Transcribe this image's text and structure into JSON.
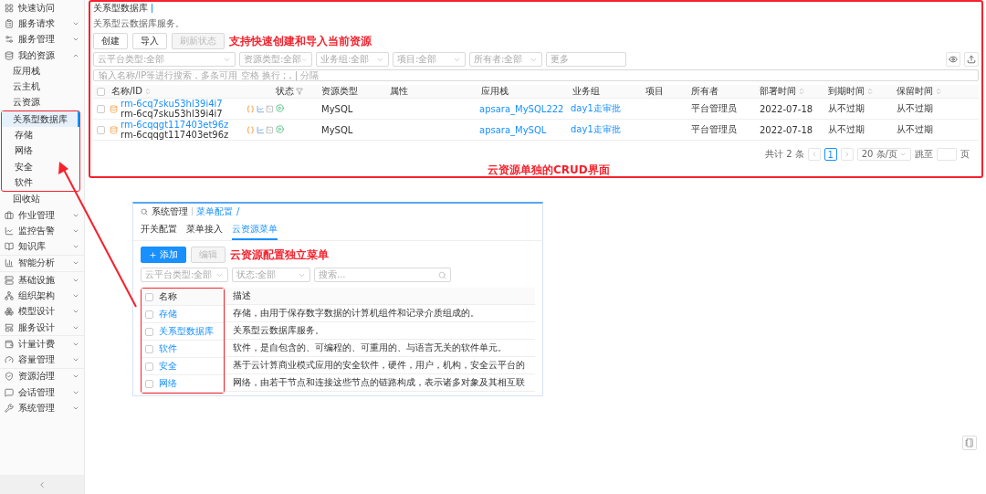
{
  "sidebar": {
    "sections": [
      {
        "items": [
          {
            "label": "快速访问"
          },
          {
            "label": "服务请求",
            "expanded": false
          },
          {
            "label": "服务管理",
            "expanded": false
          },
          {
            "label": "我的资源",
            "expanded": true,
            "children": [
              {
                "label": "应用栈",
                "selected": false,
                "highlighted": false
              },
              {
                "label": "云主机",
                "selected": false,
                "highlighted": false
              },
              {
                "label": "云资源",
                "selected": false,
                "highlighted": false
              },
              {
                "label": "关系型数据库",
                "selected": true,
                "highlighted": true
              },
              {
                "label": "存储",
                "selected": false,
                "highlighted": true
              },
              {
                "label": "网络",
                "selected": false,
                "highlighted": true
              },
              {
                "label": "安全",
                "selected": false,
                "highlighted": true
              },
              {
                "label": "软件",
                "selected": false,
                "highlighted": true
              },
              {
                "label": "回收站",
                "selected": false,
                "highlighted": false
              }
            ]
          },
          {
            "label": "作业管理",
            "expanded": false
          },
          {
            "label": "监控告警",
            "expanded": false
          },
          {
            "label": "知识库",
            "expanded": false
          }
        ]
      },
      {
        "items": [
          {
            "label": "智能分析",
            "expanded": false
          }
        ]
      },
      {
        "items": [
          {
            "label": "基础设施",
            "expanded": false
          },
          {
            "label": "组织架构",
            "expanded": false
          },
          {
            "label": "模型设计",
            "expanded": false
          },
          {
            "label": "服务设计",
            "expanded": false
          }
        ]
      },
      {
        "items": [
          {
            "label": "计量计费",
            "expanded": false
          },
          {
            "label": "容量管理",
            "expanded": false
          }
        ]
      },
      {
        "items": [
          {
            "label": "资源治理",
            "expanded": false
          },
          {
            "label": "会话管理",
            "expanded": false
          },
          {
            "label": "系统管理",
            "expanded": false
          }
        ]
      }
    ]
  },
  "resource_page": {
    "breadcrumb": "关系型数据库",
    "description": "关系型云数据库服务。",
    "buttons": [
      {
        "label": "创建",
        "disabled": false
      },
      {
        "label": "导入",
        "disabled": false
      },
      {
        "label": "刷新状态",
        "disabled": true
      }
    ],
    "annotation": "支持快速创建和导入当前资源",
    "filters": [
      {
        "label": "云平台类型:全部",
        "kind": "select"
      },
      {
        "label": "资源类型:全部",
        "kind": "select"
      },
      {
        "label": "业务组:全部",
        "kind": "select"
      },
      {
        "label": "项目:全部",
        "kind": "select"
      },
      {
        "label": "所有者:全部",
        "kind": "select"
      },
      {
        "label": "更多",
        "kind": "more"
      }
    ],
    "search": {
      "placeholder": "输入名称/IP等进行搜索，多条可用 空格 换行 ; , | 分隔"
    },
    "table": {
      "all_selected": false,
      "columns": [
        {
          "label": "名称/ID",
          "kind": "sort"
        },
        {
          "label": "状态",
          "kind": "filter"
        },
        {
          "label": "资源类型",
          "kind": "plain"
        },
        {
          "label": "属性",
          "kind": "plain"
        },
        {
          "label": "应用栈",
          "kind": "plain"
        },
        {
          "label": "业务组",
          "kind": "plain"
        },
        {
          "label": "项目",
          "kind": "plain"
        },
        {
          "label": "所有者",
          "kind": "plain"
        },
        {
          "label": "部署时间",
          "kind": "sort"
        },
        {
          "label": "到期时间",
          "kind": "sort"
        },
        {
          "label": "保留时间",
          "kind": "sort"
        }
      ],
      "rows": [
        {
          "selected": false,
          "name": "rm-6cq7sku53hl39i4i7",
          "id": "rm-6cq7sku53hl39i4i7",
          "type": "MySQL",
          "stack": "apsara_MySQL222",
          "group": "day1走审批",
          "owner": "平台管理员",
          "deployed": "2022-07-18",
          "expires": "从不过期",
          "retention": "从不过期"
        },
        {
          "selected": false,
          "name": "rm-6cqqgt117403et96z",
          "id": "rm-6cqqgt117403et96z",
          "type": "MySQL",
          "stack": "apsara_MySQL",
          "group": "day1走审批",
          "owner": "平台管理员",
          "deployed": "2022-07-18",
          "expires": "从不过期",
          "retention": "从不过期"
        }
      ]
    },
    "annotation_bottom": "云资源单独的CRUD界面",
    "pagination": {
      "total": "共计 2 条",
      "pages": [
        {
          "label": "1",
          "selected": true
        }
      ],
      "page_size": "20 条/页",
      "jump_label": "跳至",
      "page_suffix": "页"
    }
  },
  "menu_config": {
    "breadcrumb": [
      {
        "label": "系统管理",
        "selected": false
      },
      {
        "label": "菜单配置",
        "selected": true
      }
    ],
    "trail": "/",
    "tabs": [
      {
        "label": "开关配置",
        "selected": false
      },
      {
        "label": "菜单接入",
        "selected": false
      },
      {
        "label": "云资源菜单",
        "selected": true
      }
    ],
    "buttons": [
      {
        "label": "添加",
        "kind": "primary",
        "disabled": false
      },
      {
        "label": "编辑",
        "kind": "default",
        "disabled": true
      }
    ],
    "annotation": "云资源配置独立菜单",
    "filters": [
      {
        "label": "云平台类型:全部"
      },
      {
        "label": "状态:全部"
      }
    ],
    "search": {
      "placeholder": "搜索..."
    },
    "all_selected": false,
    "columns": [
      {
        "label": "名称"
      },
      {
        "label": "描述"
      }
    ],
    "rows": [
      {
        "selected": false,
        "name": "存储",
        "description": "存储，由用于保存数字数据的计算机组件和记录介质组成的。"
      },
      {
        "selected": false,
        "name": "关系型数据库",
        "description": "关系型云数据库服务。"
      },
      {
        "selected": false,
        "name": "软件",
        "description": "软件，是自包含的、可编程的、可重用的、与语言无关的软件单元。"
      },
      {
        "selected": false,
        "name": "安全",
        "description": "基于云计算商业模式应用的安全软件，硬件，用户，机构，安全云平台的"
      },
      {
        "selected": false,
        "name": "网络",
        "description": "网络，由若干节点和连接这些节点的链路构成，表示诸多对象及其相互联"
      }
    ]
  }
}
